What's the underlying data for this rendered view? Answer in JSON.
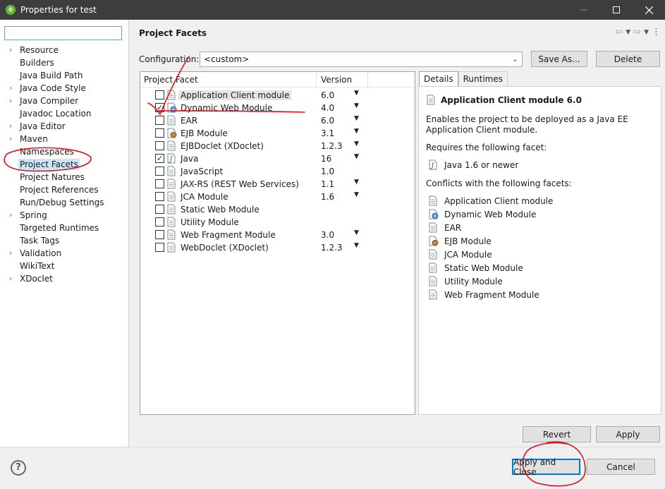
{
  "window": {
    "title": "Properties for test",
    "controls": [
      "minimize-icon",
      "maximize-icon",
      "close-icon"
    ]
  },
  "sidebar": {
    "filter_value": "",
    "items": [
      {
        "label": "Resource",
        "expandable": true
      },
      {
        "label": "Builders",
        "expandable": false
      },
      {
        "label": "Java Build Path",
        "expandable": false
      },
      {
        "label": "Java Code Style",
        "expandable": true
      },
      {
        "label": "Java Compiler",
        "expandable": true
      },
      {
        "label": "Javadoc Location",
        "expandable": false
      },
      {
        "label": "Java Editor",
        "expandable": true
      },
      {
        "label": "Maven",
        "expandable": true
      },
      {
        "label": "Namespaces",
        "expandable": false
      },
      {
        "label": "Project Facets",
        "expandable": false,
        "selected": true
      },
      {
        "label": "Project Natures",
        "expandable": false
      },
      {
        "label": "Project References",
        "expandable": false
      },
      {
        "label": "Run/Debug Settings",
        "expandable": false
      },
      {
        "label": "Spring",
        "expandable": true
      },
      {
        "label": "Targeted Runtimes",
        "expandable": false
      },
      {
        "label": "Task Tags",
        "expandable": false
      },
      {
        "label": "Validation",
        "expandable": true
      },
      {
        "label": "WikiText",
        "expandable": false
      },
      {
        "label": "XDoclet",
        "expandable": true
      }
    ]
  },
  "page": {
    "title": "Project Facets",
    "config_label": "Configuration:",
    "config_value": "<custom>",
    "save_as_label": "Save As...",
    "delete_label": "Delete"
  },
  "facets": {
    "col_facet": "Project Facet",
    "col_version": "Version",
    "rows": [
      {
        "name": "Application Client module",
        "version": "6.0",
        "dropdown": true,
        "checked": false,
        "icon": "doc-icon",
        "highlight": true
      },
      {
        "name": "Dynamic Web Module",
        "version": "4.0",
        "dropdown": true,
        "checked": true,
        "icon": "web-module-icon"
      },
      {
        "name": "EAR",
        "version": "6.0",
        "dropdown": true,
        "checked": false,
        "icon": "doc-icon"
      },
      {
        "name": "EJB Module",
        "version": "3.1",
        "dropdown": true,
        "checked": false,
        "icon": "ejb-icon"
      },
      {
        "name": "EJBDoclet (XDoclet)",
        "version": "1.2.3",
        "dropdown": true,
        "checked": false,
        "icon": "doc-icon"
      },
      {
        "name": "Java",
        "version": "16",
        "dropdown": true,
        "checked": true,
        "icon": "java-icon"
      },
      {
        "name": "JavaScript",
        "version": "1.0",
        "dropdown": false,
        "checked": false,
        "icon": "doc-icon"
      },
      {
        "name": "JAX-RS (REST Web Services)",
        "version": "1.1",
        "dropdown": true,
        "checked": false,
        "icon": "doc-icon"
      },
      {
        "name": "JCA Module",
        "version": "1.6",
        "dropdown": true,
        "checked": false,
        "icon": "doc-icon"
      },
      {
        "name": "Static Web Module",
        "version": "",
        "dropdown": false,
        "checked": false,
        "icon": "doc-icon"
      },
      {
        "name": "Utility Module",
        "version": "",
        "dropdown": false,
        "checked": false,
        "icon": "doc-icon"
      },
      {
        "name": "Web Fragment Module",
        "version": "3.0",
        "dropdown": true,
        "checked": false,
        "icon": "doc-icon"
      },
      {
        "name": "WebDoclet (XDoclet)",
        "version": "1.2.3",
        "dropdown": true,
        "checked": false,
        "icon": "doc-icon"
      }
    ]
  },
  "details": {
    "tab_details": "Details",
    "tab_runtimes": "Runtimes",
    "title": "Application Client module 6.0",
    "description": "Enables the project to be deployed as a Java EE Application Client module.",
    "requires_label": "Requires the following facet:",
    "requires_item": "Java 1.6 or newer",
    "conflicts_label": "Conflicts with the following facets:",
    "conflicts": [
      {
        "name": "Application Client module",
        "icon": "doc-icon"
      },
      {
        "name": "Dynamic Web Module",
        "icon": "web-module-icon"
      },
      {
        "name": "EAR",
        "icon": "doc-icon"
      },
      {
        "name": "EJB Module",
        "icon": "ejb-icon"
      },
      {
        "name": "JCA Module",
        "icon": "doc-icon"
      },
      {
        "name": "Static Web Module",
        "icon": "doc-icon"
      },
      {
        "name": "Utility Module",
        "icon": "doc-icon"
      },
      {
        "name": "Web Fragment Module",
        "icon": "doc-icon"
      }
    ]
  },
  "buttons": {
    "revert": "Revert",
    "apply": "Apply",
    "apply_and_close": "Apply and Close",
    "cancel": "Cancel",
    "help": "?"
  },
  "colors": {
    "titlebar": "#3d3d3d",
    "selection": "#cce4f7",
    "focus_border": "#0078d7",
    "annotation_ink": "#e0101a"
  }
}
